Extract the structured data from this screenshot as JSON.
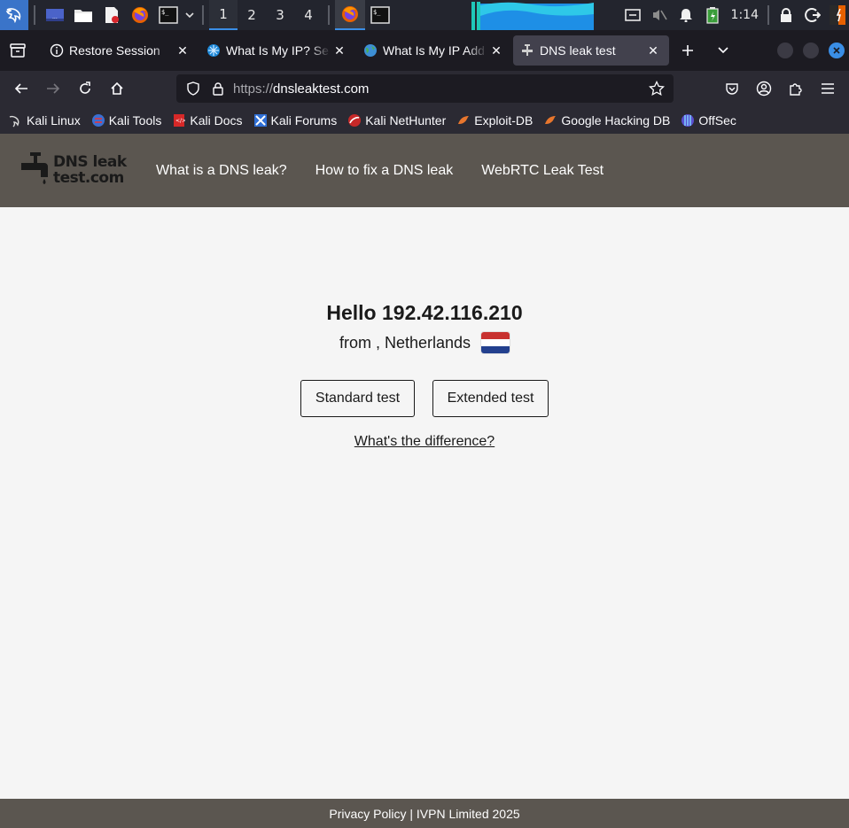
{
  "taskbar": {
    "workspaces": [
      "1",
      "2",
      "3",
      "4"
    ],
    "clock": "1:14"
  },
  "tabs": [
    {
      "title": "Restore Session",
      "favicon": "info-icon"
    },
    {
      "title": "What Is My IP? Se",
      "favicon": "globe-snowflake-icon"
    },
    {
      "title": "What Is My IP Add",
      "favicon": "earth-icon"
    },
    {
      "title": "DNS leak test",
      "favicon": "dnsleak-tap-icon",
      "selected": true
    }
  ],
  "urlbar": {
    "scheme": "https://",
    "host": "dnsleaktest.com"
  },
  "bookmarks": [
    {
      "label": "Kali Linux",
      "icon": "kali-dragon-icon"
    },
    {
      "label": "Kali Tools",
      "icon": "kali-tools-icon"
    },
    {
      "label": "Kali Docs",
      "icon": "kali-docs-icon"
    },
    {
      "label": "Kali Forums",
      "icon": "kali-forums-icon"
    },
    {
      "label": "Kali NetHunter",
      "icon": "nethunter-icon"
    },
    {
      "label": "Exploit-DB",
      "icon": "exploit-db-icon"
    },
    {
      "label": "Google Hacking DB",
      "icon": "ghdb-icon"
    },
    {
      "label": "OffSec",
      "icon": "offsec-icon"
    }
  ],
  "site": {
    "logo_line1": "DNS leak",
    "logo_line2": "test.com",
    "nav": [
      "What is a DNS leak?",
      "How to fix a DNS leak",
      "WebRTC Leak Test"
    ],
    "hello": "Hello 192.42.116.210",
    "from": "from , Netherlands",
    "buttons": {
      "standard": "Standard test",
      "extended": "Extended test"
    },
    "difference_link": "What's the difference?",
    "footer": "Privacy Policy | IVPN Limited 2025"
  },
  "colors": {
    "header_bg": "#5b5650",
    "page_bg": "#f5f5f5",
    "firefox_toolbar": "#2b2a33",
    "flag_red": "#c8312f",
    "flag_white": "#ffffff",
    "flag_blue": "#23408e"
  }
}
